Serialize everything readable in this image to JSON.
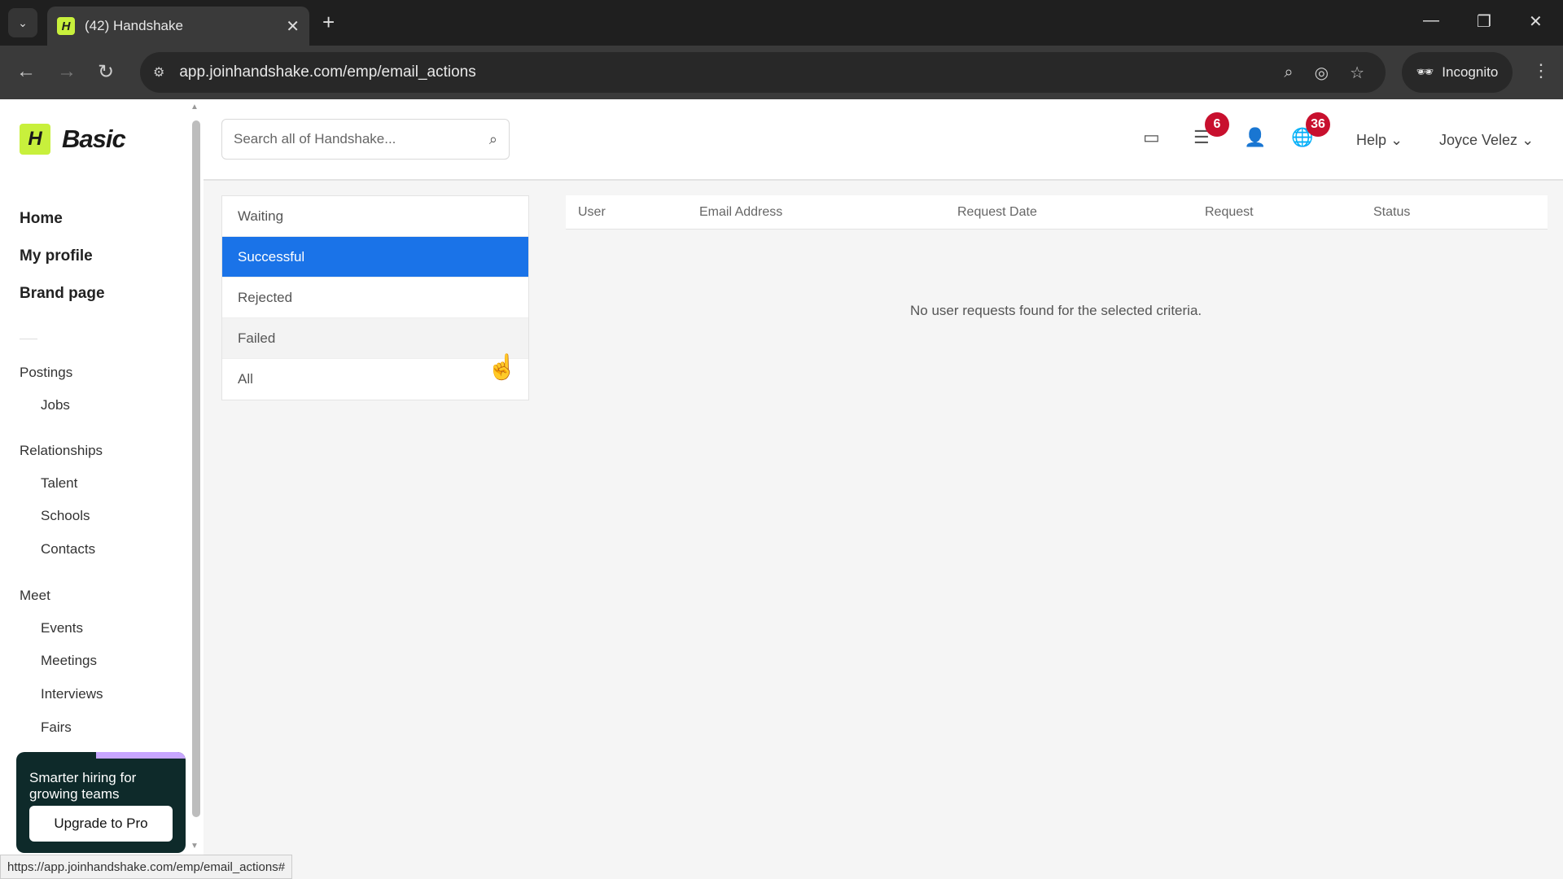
{
  "browser": {
    "tab_title": "(42) Handshake",
    "favicon_letter": "H",
    "url": "app.joinhandshake.com/emp/email_actions",
    "incognito_label": "Incognito",
    "status_url": "https://app.joinhandshake.com/emp/email_actions#"
  },
  "brand": {
    "logo_letter": "H",
    "plan": "Basic"
  },
  "sidebar": {
    "main_links": [
      "Home",
      "My profile",
      "Brand page"
    ],
    "sections": {
      "postings": {
        "label": "Postings",
        "items": [
          "Jobs"
        ]
      },
      "relationships": {
        "label": "Relationships",
        "items": [
          "Talent",
          "Schools",
          "Contacts"
        ]
      },
      "meet": {
        "label": "Meet",
        "items": [
          "Events",
          "Meetings",
          "Interviews",
          "Fairs"
        ]
      }
    },
    "promo": {
      "text": "Smarter hiring for growing teams",
      "button": "Upgrade to Pro"
    }
  },
  "header": {
    "search_placeholder": "Search all of Handshake...",
    "messages_badge": "6",
    "notifications_badge": "36",
    "help_label": "Help",
    "user_name": "Joyce Velez"
  },
  "filters": {
    "items": [
      "Waiting",
      "Successful",
      "Rejected",
      "Failed",
      "All"
    ],
    "selected": "Successful"
  },
  "table": {
    "columns": [
      "User",
      "Email Address",
      "Request Date",
      "Request",
      "Status"
    ],
    "empty_message": "No user requests found for the selected criteria."
  },
  "colors": {
    "accent": "#1a73e8",
    "brand": "#c8f03c",
    "badge": "#c8102e"
  }
}
